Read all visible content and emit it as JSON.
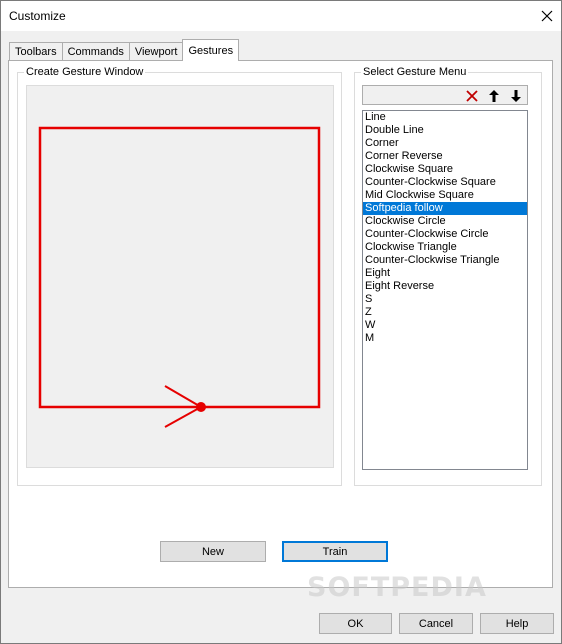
{
  "window": {
    "title": "Customize",
    "close_label": "×"
  },
  "tabs": [
    {
      "label": "Toolbars",
      "active": false
    },
    {
      "label": "Commands",
      "active": false
    },
    {
      "label": "Viewport",
      "active": false
    },
    {
      "label": "Gestures",
      "active": true
    }
  ],
  "gesture_window": {
    "label": "Create Gesture Window",
    "stroke_color": "#e60000"
  },
  "gesture_menu": {
    "label": "Select Gesture Menu",
    "toolbar_icons": [
      "delete-x-icon",
      "arrow-up-icon",
      "arrow-down-icon"
    ],
    "items": [
      "Line",
      "Double Line",
      "Corner",
      "Corner Reverse",
      "Clockwise Square",
      "Counter-Clockwise Square",
      "Mid Clockwise Square",
      "Softpedia follow",
      "Clockwise Circle",
      "Counter-Clockwise Circle",
      "Clockwise Triangle",
      "Counter-Clockwise Triangle",
      "Eight",
      "Eight Reverse",
      "S",
      "Z",
      "W",
      "M"
    ],
    "selected_index": 7,
    "selection_color": "#0078d7"
  },
  "panel_buttons": {
    "new_label": "New",
    "train_label": "Train"
  },
  "dialog_buttons": {
    "ok_label": "OK",
    "cancel_label": "Cancel",
    "help_label": "Help"
  },
  "watermark": "SOFTPEDIA"
}
